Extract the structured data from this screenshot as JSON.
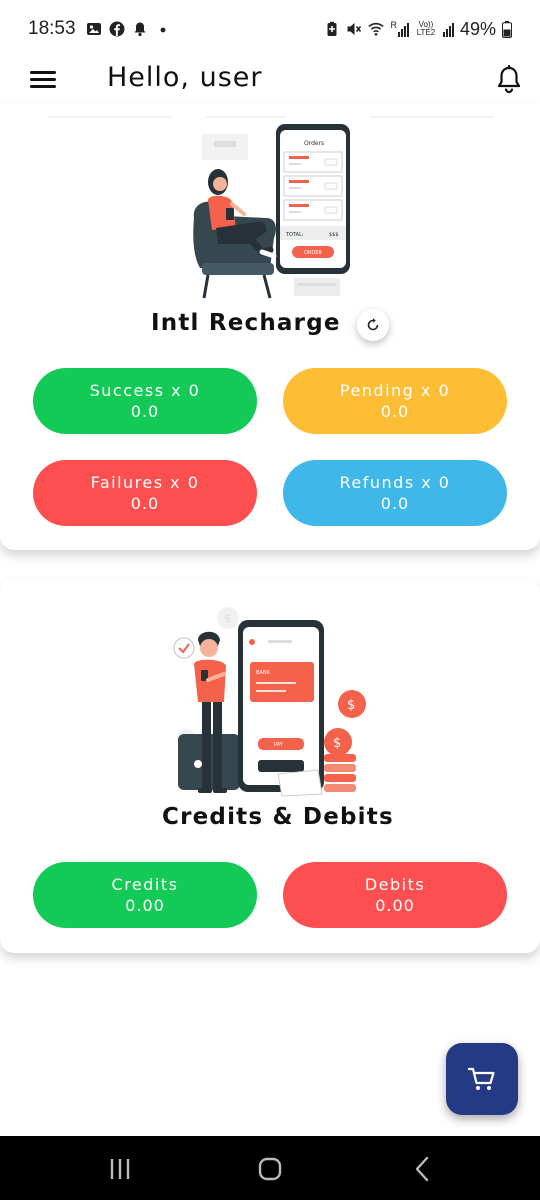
{
  "status_bar": {
    "time": "18:53",
    "battery": "49%",
    "left_icons": [
      "image-icon",
      "facebook-icon",
      "notification-bell-icon",
      "dot-icon"
    ],
    "right_icons": [
      "battery-saver-icon",
      "mute-icon",
      "wifi-icon",
      "signal-r-icon",
      "volte-lte2-icon",
      "signal-icon",
      "battery-icon"
    ],
    "volte_text": "Vo)) LTE2",
    "roaming_text": "R"
  },
  "app_bar": {
    "title": "Hello, user",
    "menu_icon": "hamburger-menu-icon",
    "notification_icon": "bell-icon"
  },
  "intl_recharge": {
    "title": "Intl Recharge",
    "refresh_icon": "refresh-icon",
    "illustration": {
      "orders_title": "Orders",
      "total_label": "TOTAL:",
      "total_value": "$$$",
      "button_label": "ORDER"
    },
    "stats": [
      {
        "label": "Success x 0",
        "value": "0.0",
        "color": "#14ca57"
      },
      {
        "label": "Pending x 0",
        "value": "0.0",
        "color": "#fdbd35"
      },
      {
        "label": "Failures x 0",
        "value": "0.0",
        "color": "#fd4f4f"
      },
      {
        "label": "Refunds x 0",
        "value": "0.0",
        "color": "#3fb7e8"
      }
    ]
  },
  "credits_debits": {
    "title": "Credits & Debits",
    "illustration": {
      "card_label": "BANK",
      "pay_label": "PAY"
    },
    "stats": [
      {
        "label": "Credits",
        "value": "0.00",
        "color": "#14ca57"
      },
      {
        "label": "Debits",
        "value": "0.00",
        "color": "#fd4f4f"
      }
    ]
  },
  "fab": {
    "icon": "shopping-cart-icon",
    "color": "#243a85"
  },
  "nav_bar": {
    "icons": [
      "recent-apps-icon",
      "home-icon",
      "back-icon"
    ]
  }
}
